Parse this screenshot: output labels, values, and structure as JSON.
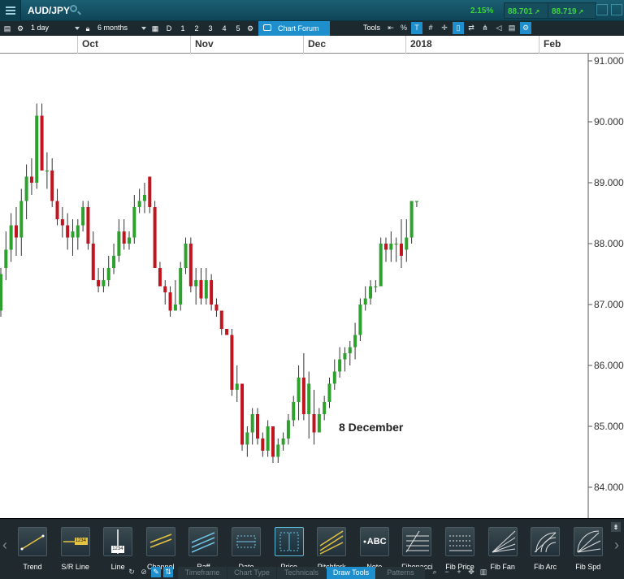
{
  "topbar": {
    "symbol": "AUD/JPY",
    "change": "2.15%",
    "sell": "88.701",
    "buy": "88.719",
    "colors": {
      "up": "#3ed43e",
      "bar": "#124f60"
    }
  },
  "toolbar": {
    "interval": "1 day",
    "range": "6 months",
    "buttons": [
      "D",
      "1",
      "2",
      "3",
      "4",
      "5"
    ],
    "forum": "Chart Forum",
    "tools_label": "Tools",
    "icons": [
      "window-icon",
      "percent-icon",
      "text-icon",
      "crosshair-icon",
      "expand-icon",
      "compare-icon",
      "candle-icon",
      "scale-icon",
      "indicator-icon",
      "eraser-icon",
      "print-icon",
      "settings-icon"
    ]
  },
  "months": [
    "Oct",
    "Nov",
    "Dec",
    "2018",
    "Feb"
  ],
  "chart_data": {
    "type": "candlestick",
    "yticks": [
      "91.000",
      "90.000",
      "89.000",
      "88.000",
      "87.000",
      "86.000",
      "85.000",
      "84.000"
    ],
    "ylim": [
      83.6,
      91.2
    ],
    "annotation": "8 December",
    "colors": {
      "up": "#2ea02e",
      "down": "#c0141e",
      "wick": "#333333"
    },
    "candles": [
      {
        "o": 86.9,
        "h": 87.6,
        "l": 86.8,
        "c": 87.5
      },
      {
        "o": 87.6,
        "h": 88.2,
        "l": 87.4,
        "c": 87.9
      },
      {
        "o": 87.9,
        "h": 88.5,
        "l": 87.7,
        "c": 88.3
      },
      {
        "o": 88.3,
        "h": 88.6,
        "l": 87.8,
        "c": 88.1
      },
      {
        "o": 88.1,
        "h": 88.9,
        "l": 87.8,
        "c": 88.7
      },
      {
        "o": 88.7,
        "h": 89.3,
        "l": 88.4,
        "c": 89.1
      },
      {
        "o": 89.1,
        "h": 89.4,
        "l": 88.8,
        "c": 89.0
      },
      {
        "o": 89.0,
        "h": 90.3,
        "l": 88.9,
        "c": 90.1
      },
      {
        "o": 90.1,
        "h": 90.3,
        "l": 89.2,
        "c": 89.2
      },
      {
        "o": 89.2,
        "h": 89.5,
        "l": 88.9,
        "c": 89.2
      },
      {
        "o": 89.2,
        "h": 89.4,
        "l": 88.6,
        "c": 88.7
      },
      {
        "o": 88.7,
        "h": 88.9,
        "l": 88.3,
        "c": 88.4
      },
      {
        "o": 88.4,
        "h": 88.6,
        "l": 88.1,
        "c": 88.3
      },
      {
        "o": 88.3,
        "h": 88.5,
        "l": 87.9,
        "c": 88.1
      },
      {
        "o": 88.1,
        "h": 88.4,
        "l": 87.8,
        "c": 88.2
      },
      {
        "o": 88.1,
        "h": 88.4,
        "l": 87.9,
        "c": 88.3
      },
      {
        "o": 88.3,
        "h": 88.7,
        "l": 88.2,
        "c": 88.6
      },
      {
        "o": 88.6,
        "h": 88.7,
        "l": 87.9,
        "c": 88.0
      },
      {
        "o": 88.0,
        "h": 88.2,
        "l": 87.4,
        "c": 87.4
      },
      {
        "o": 87.4,
        "h": 87.6,
        "l": 87.2,
        "c": 87.3
      },
      {
        "o": 87.3,
        "h": 87.6,
        "l": 87.2,
        "c": 87.4
      },
      {
        "o": 87.4,
        "h": 87.8,
        "l": 87.3,
        "c": 87.6
      },
      {
        "o": 87.6,
        "h": 88.0,
        "l": 87.5,
        "c": 87.8
      },
      {
        "o": 87.8,
        "h": 88.4,
        "l": 87.7,
        "c": 88.2
      },
      {
        "o": 88.2,
        "h": 88.4,
        "l": 87.9,
        "c": 88.0
      },
      {
        "o": 88.0,
        "h": 88.2,
        "l": 87.9,
        "c": 88.1
      },
      {
        "o": 88.1,
        "h": 88.8,
        "l": 88.0,
        "c": 88.6
      },
      {
        "o": 88.6,
        "h": 88.9,
        "l": 88.5,
        "c": 88.7
      },
      {
        "o": 88.7,
        "h": 89.0,
        "l": 88.5,
        "c": 88.8
      },
      {
        "o": 89.1,
        "h": 89.1,
        "l": 88.5,
        "c": 88.6
      },
      {
        "o": 88.6,
        "h": 88.7,
        "l": 87.6,
        "c": 87.6
      },
      {
        "o": 87.6,
        "h": 87.7,
        "l": 87.3,
        "c": 87.3
      },
      {
        "o": 87.3,
        "h": 87.4,
        "l": 87.0,
        "c": 87.2
      },
      {
        "o": 87.2,
        "h": 87.3,
        "l": 86.8,
        "c": 86.9
      },
      {
        "o": 86.9,
        "h": 87.4,
        "l": 86.9,
        "c": 87.0
      },
      {
        "o": 87.0,
        "h": 87.7,
        "l": 86.9,
        "c": 87.6
      },
      {
        "o": 87.6,
        "h": 88.1,
        "l": 87.5,
        "c": 88.0
      },
      {
        "o": 88.0,
        "h": 88.1,
        "l": 87.2,
        "c": 87.3
      },
      {
        "o": 87.3,
        "h": 87.6,
        "l": 87.0,
        "c": 87.4
      },
      {
        "o": 87.4,
        "h": 87.6,
        "l": 87.0,
        "c": 87.1
      },
      {
        "o": 87.1,
        "h": 87.6,
        "l": 87.0,
        "c": 87.4
      },
      {
        "o": 87.4,
        "h": 87.5,
        "l": 86.9,
        "c": 87.0
      },
      {
        "o": 87.0,
        "h": 87.1,
        "l": 86.8,
        "c": 86.9
      },
      {
        "o": 86.9,
        "h": 86.9,
        "l": 86.5,
        "c": 86.6
      },
      {
        "o": 86.6,
        "h": 86.6,
        "l": 86.5,
        "c": 86.5
      },
      {
        "o": 86.5,
        "h": 86.6,
        "l": 85.5,
        "c": 85.6
      },
      {
        "o": 85.6,
        "h": 86.0,
        "l": 85.4,
        "c": 85.7
      },
      {
        "o": 85.7,
        "h": 85.7,
        "l": 84.6,
        "c": 84.7
      },
      {
        "o": 84.7,
        "h": 85.0,
        "l": 84.5,
        "c": 84.9
      },
      {
        "o": 84.9,
        "h": 85.3,
        "l": 84.7,
        "c": 85.2
      },
      {
        "o": 85.2,
        "h": 85.3,
        "l": 84.7,
        "c": 84.8
      },
      {
        "o": 84.8,
        "h": 84.9,
        "l": 84.5,
        "c": 84.6
      },
      {
        "o": 84.6,
        "h": 85.1,
        "l": 84.5,
        "c": 85.0
      },
      {
        "o": 85.0,
        "h": 85.0,
        "l": 84.4,
        "c": 84.5
      },
      {
        "o": 84.5,
        "h": 84.8,
        "l": 84.4,
        "c": 84.7
      },
      {
        "o": 84.7,
        "h": 84.9,
        "l": 84.6,
        "c": 84.8
      },
      {
        "o": 84.8,
        "h": 85.2,
        "l": 84.7,
        "c": 85.1
      },
      {
        "o": 85.1,
        "h": 85.5,
        "l": 85.0,
        "c": 85.4
      },
      {
        "o": 85.4,
        "h": 86.0,
        "l": 85.1,
        "c": 85.8
      },
      {
        "o": 85.8,
        "h": 86.2,
        "l": 85.1,
        "c": 85.2
      },
      {
        "o": 85.2,
        "h": 85.9,
        "l": 84.8,
        "c": 85.7
      },
      {
        "o": 85.2,
        "h": 85.6,
        "l": 84.7,
        "c": 84.9
      },
      {
        "o": 84.9,
        "h": 85.3,
        "l": 84.9,
        "c": 85.2
      },
      {
        "o": 85.2,
        "h": 85.5,
        "l": 85.1,
        "c": 85.4
      },
      {
        "o": 85.4,
        "h": 85.8,
        "l": 85.3,
        "c": 85.7
      },
      {
        "o": 85.7,
        "h": 86.1,
        "l": 85.6,
        "c": 85.9
      },
      {
        "o": 85.9,
        "h": 86.3,
        "l": 85.8,
        "c": 86.1
      },
      {
        "o": 86.1,
        "h": 86.3,
        "l": 85.9,
        "c": 86.2
      },
      {
        "o": 86.2,
        "h": 86.4,
        "l": 86.0,
        "c": 86.3
      },
      {
        "o": 86.3,
        "h": 86.7,
        "l": 86.1,
        "c": 86.5
      },
      {
        "o": 86.5,
        "h": 87.1,
        "l": 86.4,
        "c": 87.0
      },
      {
        "o": 87.0,
        "h": 87.3,
        "l": 86.9,
        "c": 87.1
      },
      {
        "o": 87.1,
        "h": 87.4,
        "l": 87.0,
        "c": 87.3
      },
      {
        "o": 87.3,
        "h": 87.4,
        "l": 87.2,
        "c": 87.3
      },
      {
        "o": 87.3,
        "h": 88.1,
        "l": 87.3,
        "c": 88.0
      },
      {
        "o": 88.0,
        "h": 88.1,
        "l": 87.7,
        "c": 87.9
      },
      {
        "o": 87.9,
        "h": 88.2,
        "l": 87.7,
        "c": 88.0
      },
      {
        "o": 88.0,
        "h": 88.1,
        "l": 87.7,
        "c": 88.0
      },
      {
        "o": 88.0,
        "h": 88.4,
        "l": 87.6,
        "c": 87.8
      },
      {
        "o": 87.9,
        "h": 88.4,
        "l": 87.7,
        "c": 88.1
      },
      {
        "o": 88.1,
        "h": 88.7,
        "l": 88.0,
        "c": 88.7
      },
      {
        "o": 88.7,
        "h": 88.7,
        "l": 88.6,
        "c": 88.7
      }
    ]
  },
  "draw_tools": [
    {
      "name": "trend",
      "label": "Trend"
    },
    {
      "name": "sr-line",
      "label": "S/R Line"
    },
    {
      "name": "line",
      "label": "Line"
    },
    {
      "name": "channel",
      "label": "Channel"
    },
    {
      "name": "raff",
      "label": "Raff"
    },
    {
      "name": "date",
      "label": "Date"
    },
    {
      "name": "price",
      "label": "Price"
    },
    {
      "name": "pitchfork",
      "label": "Pitchfork"
    },
    {
      "name": "note",
      "label": "Note"
    },
    {
      "name": "fibonacci",
      "label": "Fibonacci"
    },
    {
      "name": "fib-price",
      "label": "Fib Price"
    },
    {
      "name": "fib-fan",
      "label": "Fib Fan"
    },
    {
      "name": "fib-arc",
      "label": "Fib Arc"
    },
    {
      "name": "fib-spd",
      "label": "Fib Spd"
    }
  ],
  "tool_badges": {
    "sr": "1234",
    "line": "1234",
    "note": "ABC"
  },
  "bottom_tabs": [
    "Timeframe",
    "Chart Type",
    "Technicals",
    "Draw Tools",
    "Patterns"
  ],
  "active_tab": "Draw Tools"
}
